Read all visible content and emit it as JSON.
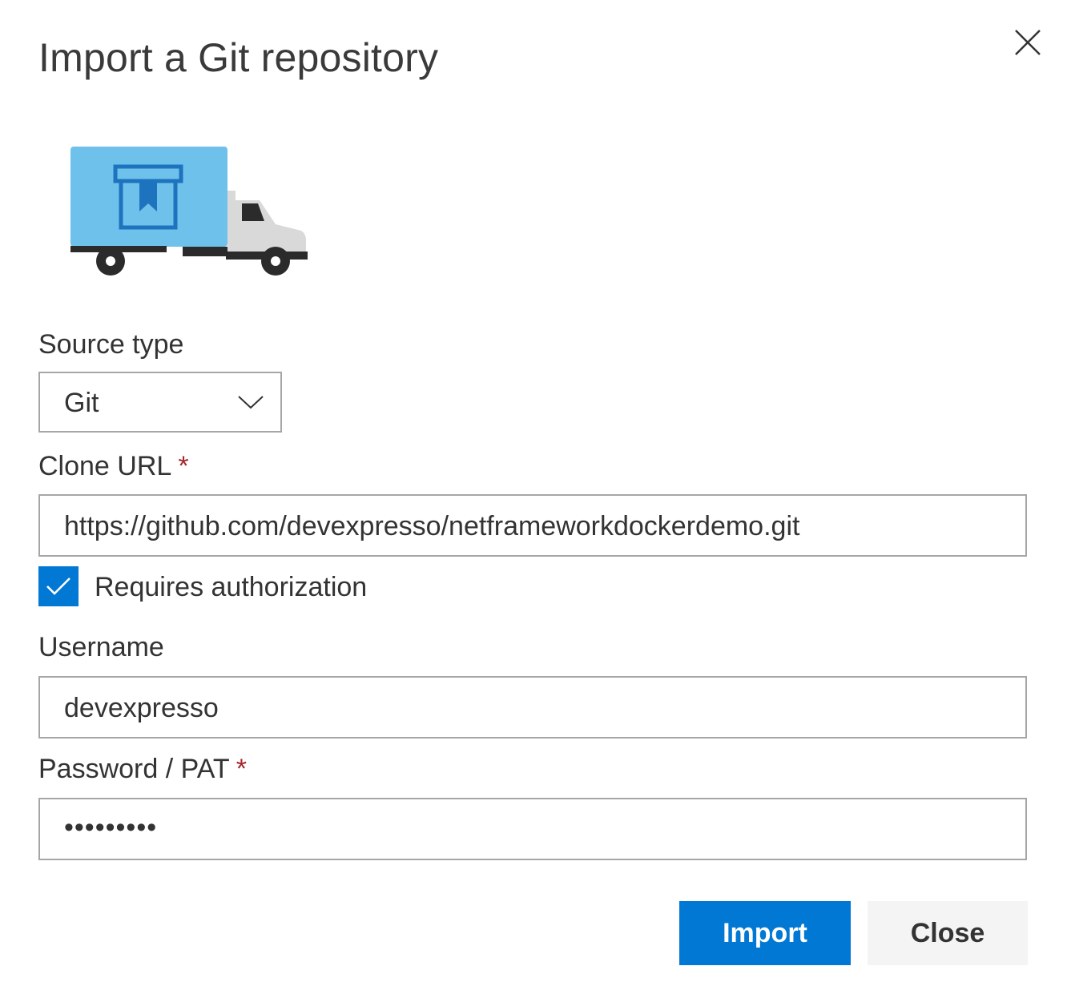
{
  "dialog": {
    "title": "Import a Git repository",
    "close_icon": "close-icon"
  },
  "illustration": {
    "icon": "truck-with-repository-icon",
    "colors": {
      "cargo": "#6ec1ea",
      "repo": "#1e73be",
      "cab": "#d9d9d9",
      "dark": "#2b2b2b"
    }
  },
  "form": {
    "source_type": {
      "label": "Source type",
      "value": "Git",
      "icon": "chevron-down-icon"
    },
    "clone_url": {
      "label": "Clone URL",
      "required_marker": "*",
      "value": "https://github.com/devexpresso/netframeworkdockerdemo.git"
    },
    "requires_authorization": {
      "label": "Requires authorization",
      "checked": true,
      "icon": "checkmark-icon"
    },
    "username": {
      "label": "Username",
      "value": "devexpresso"
    },
    "password": {
      "label": "Password / PAT",
      "required_marker": "*",
      "masked_value": "•••••••••"
    }
  },
  "actions": {
    "import_label": "Import",
    "close_label": "Close"
  },
  "colors": {
    "accent": "#0078d4",
    "required": "#a4262c",
    "border": "#a6a6a6",
    "secondary_button": "#f4f4f4"
  }
}
